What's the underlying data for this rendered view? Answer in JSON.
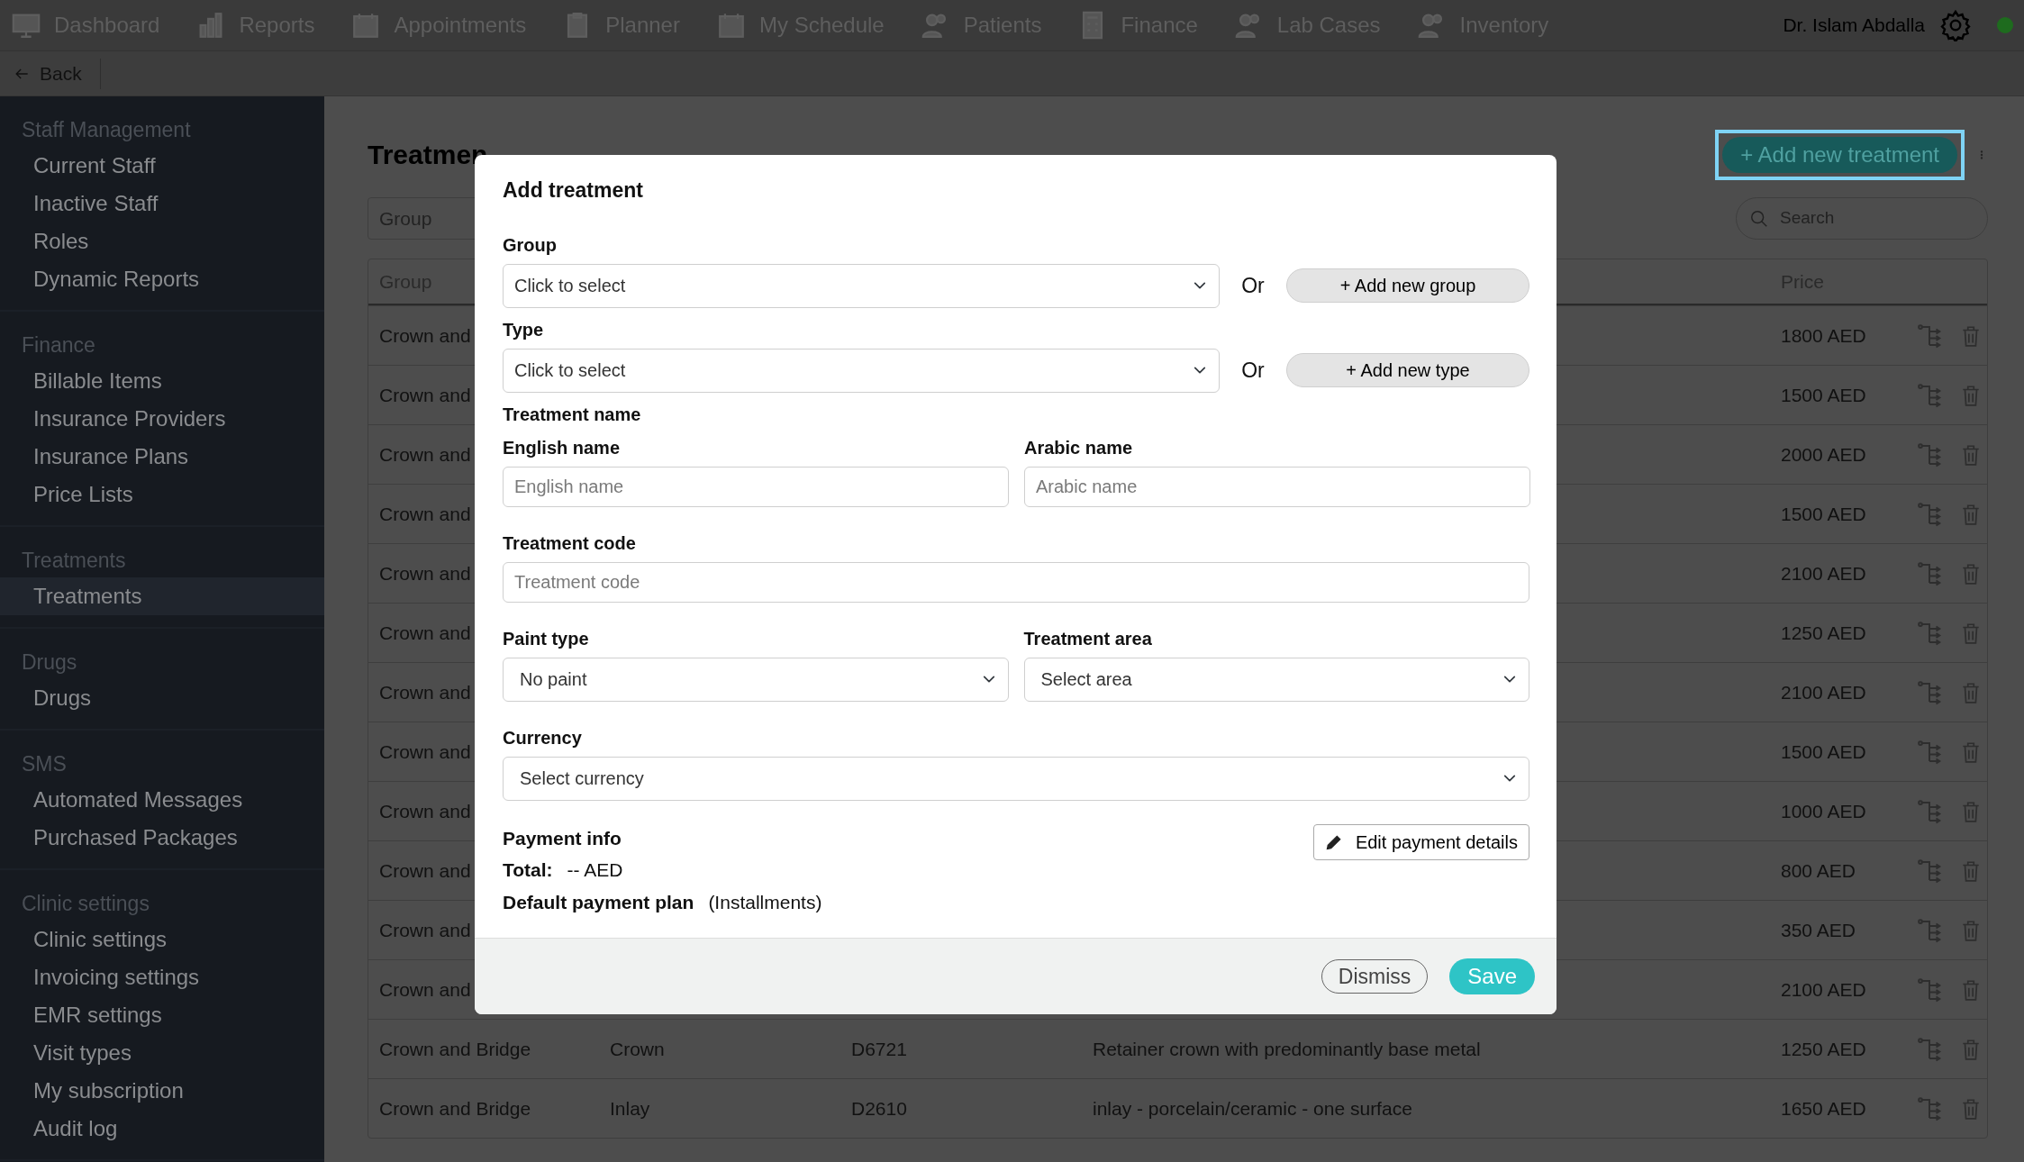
{
  "top_nav": {
    "items": [
      {
        "label": "Dashboard"
      },
      {
        "label": "Reports"
      },
      {
        "label": "Appointments"
      },
      {
        "label": "Planner"
      },
      {
        "label": "My Schedule"
      },
      {
        "label": "Patients"
      },
      {
        "label": "Finance"
      },
      {
        "label": "Lab Cases"
      },
      {
        "label": "Inventory"
      }
    ],
    "user": "Dr. Islam Abdalla"
  },
  "back_button": "Back",
  "sidebar": {
    "sections": [
      {
        "title": "Staff Management",
        "items": [
          {
            "label": "Current Staff",
            "selected": false
          },
          {
            "label": "Inactive Staff",
            "selected": false
          },
          {
            "label": "Roles",
            "selected": false
          },
          {
            "label": "Dynamic Reports",
            "selected": false
          }
        ]
      },
      {
        "title": "Finance",
        "items": [
          {
            "label": "Billable Items",
            "selected": false
          },
          {
            "label": "Insurance Providers",
            "selected": false
          },
          {
            "label": "Insurance Plans",
            "selected": false
          },
          {
            "label": "Price Lists",
            "selected": false
          }
        ]
      },
      {
        "title": "Treatments",
        "items": [
          {
            "label": "Treatments",
            "selected": true
          }
        ]
      },
      {
        "title": "Drugs",
        "items": [
          {
            "label": "Drugs",
            "selected": false
          }
        ]
      },
      {
        "title": "SMS",
        "items": [
          {
            "label": "Automated Messages",
            "selected": false
          },
          {
            "label": "Purchased Packages",
            "selected": false
          }
        ]
      },
      {
        "title": "Clinic settings",
        "items": [
          {
            "label": "Clinic settings",
            "selected": false
          },
          {
            "label": "Invoicing settings",
            "selected": false
          },
          {
            "label": "EMR settings",
            "selected": false
          },
          {
            "label": "Visit types",
            "selected": false
          },
          {
            "label": "My subscription",
            "selected": false
          },
          {
            "label": "Audit log",
            "selected": false
          }
        ]
      }
    ]
  },
  "page": {
    "title": "Treatmen",
    "add_button": {
      "label": "+ Add new treatment",
      "focused": true
    },
    "group_filter": {
      "value": "Group"
    },
    "search": {
      "placeholder": "Search"
    }
  },
  "table": {
    "header": {
      "group": "Group",
      "price": "Price"
    },
    "rows": [
      {
        "group": "Crown and",
        "price": "1800 AED"
      },
      {
        "group": "Crown and",
        "price": "1500 AED"
      },
      {
        "group": "Crown and",
        "price": "2000 AED"
      },
      {
        "group": "Crown and",
        "price": "1500 AED"
      },
      {
        "group": "Crown and",
        "price": "2100 AED"
      },
      {
        "group": "Crown and",
        "price": "1250 AED"
      },
      {
        "group": "Crown and",
        "price": "2100 AED"
      },
      {
        "group": "Crown and",
        "price": "1500 AED"
      },
      {
        "group": "Crown and",
        "price": "1000 AED"
      },
      {
        "group": "Crown and",
        "price": "800 AED"
      },
      {
        "group": "Crown and",
        "price": "350 AED"
      },
      {
        "group": "Crown and",
        "price": "2100 AED"
      },
      {
        "group": "Crown and Bridge",
        "type": "Crown",
        "code": "D6721",
        "description": "Retainer crown with predominantly base metal",
        "price": "1250 AED"
      },
      {
        "group": "Crown and Bridge",
        "type": "Inlay",
        "code": "D2610",
        "description": "inlay - porcelain/ceramic - one surface",
        "price": "1650 AED"
      }
    ]
  },
  "modal": {
    "title": "Add treatment",
    "group": {
      "label": "Group",
      "value": "Click to select",
      "or": "Or",
      "add_button": "+ Add new group"
    },
    "type": {
      "label": "Type",
      "value": "Click to select",
      "or": "Or",
      "add_button": "+ Add new type"
    },
    "treatment_name": {
      "label": "Treatment name",
      "english": {
        "label": "English name",
        "placeholder": "English name"
      },
      "arabic": {
        "label": "Arabic name",
        "placeholder": "Arabic name"
      }
    },
    "treatment_code": {
      "label": "Treatment code",
      "placeholder": "Treatment code"
    },
    "paint_type": {
      "label": "Paint type",
      "value": "No paint"
    },
    "treatment_area": {
      "label": "Treatment area",
      "value": "Select area"
    },
    "currency": {
      "label": "Currency",
      "value": "Select currency"
    },
    "payment_info": {
      "label": "Payment info",
      "total_label": "Total:",
      "total_value": "-- AED",
      "plan_label": "Default payment plan",
      "plan_value": "(Installments)",
      "edit_button": "Edit payment details"
    },
    "buttons": {
      "dismiss": "Dismiss",
      "save": "Save"
    }
  }
}
